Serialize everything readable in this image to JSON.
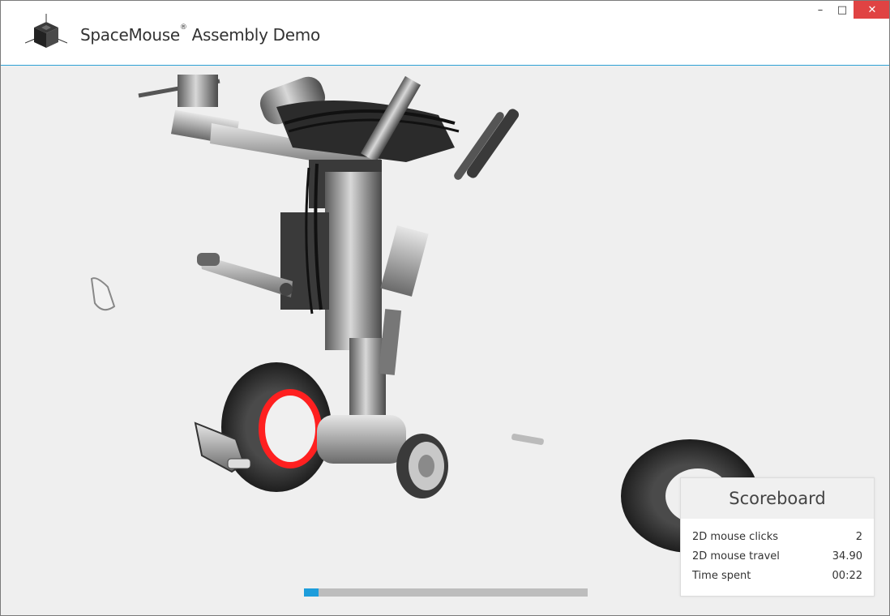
{
  "window": {
    "app_title_brand": "SpaceMouse",
    "app_title_reg": "®",
    "app_title_rest": " Assembly Demo",
    "controls": {
      "minimize": "–",
      "maximize": "□",
      "close": "✕"
    }
  },
  "icons": {
    "logo": "cube-logo-icon",
    "minimize": "minimize-icon",
    "maximize": "maximize-icon",
    "close": "close-icon"
  },
  "progress": {
    "fraction": 0.05
  },
  "scoreboard": {
    "title": "Scoreboard",
    "rows": [
      {
        "label": "2D mouse clicks",
        "value": "2"
      },
      {
        "label": "2D mouse travel",
        "value": "34.90"
      },
      {
        "label": "Time spent",
        "value": "00:22"
      }
    ]
  },
  "colors": {
    "accent": "#1d9ddb",
    "close_button": "#e04343",
    "highlight_ring": "#ff2020",
    "background": "#efefef"
  }
}
